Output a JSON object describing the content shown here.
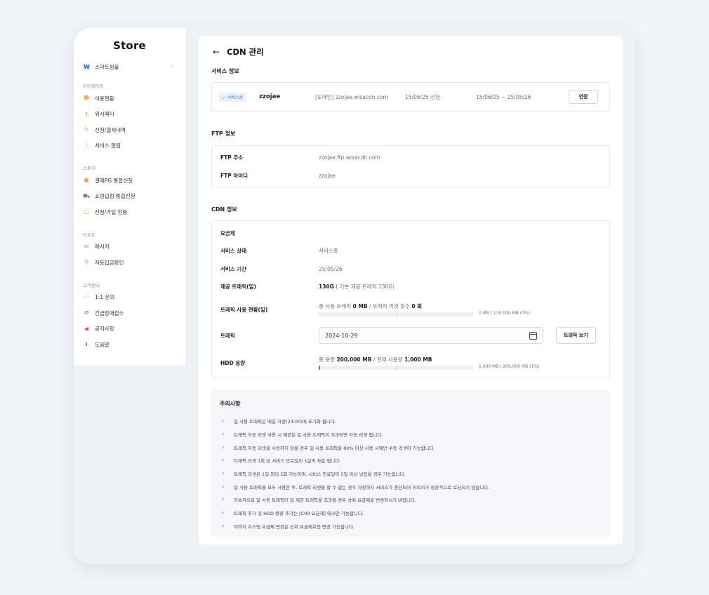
{
  "sidebar": {
    "brand": "Store",
    "smart": {
      "logo": "W",
      "label": "스마트윙올"
    },
    "sections": [
      {
        "title": "마이페이지",
        "items": [
          {
            "label": "이용현황",
            "icon": "smile-icon",
            "glyph": "☻",
            "color": "#f5a524"
          },
          {
            "label": "위시페이",
            "icon": "key-icon",
            "glyph": "⚷",
            "color": "#f2a516"
          },
          {
            "label": "신청/결제내역",
            "icon": "memo-icon",
            "glyph": "✎",
            "color": "#e8a23b"
          },
          {
            "label": "서비스 알림",
            "icon": "bell-icon",
            "glyph": "♪",
            "color": "#f0b429"
          }
        ]
      },
      {
        "title": "스토어",
        "items": [
          {
            "label": "결제PG 통합신청",
            "icon": "moneybag-icon",
            "glyph": "●",
            "color": "#e9a83a"
          },
          {
            "label": "쇼핑입점 통합신청",
            "icon": "cart-icon",
            "glyph": "⛟",
            "color": "#6b7280"
          },
          {
            "label": "신청/가입 현황",
            "icon": "clipboard-icon",
            "glyph": "▢",
            "color": "#e0a93e"
          }
        ]
      },
      {
        "title": "리포트",
        "items": [
          {
            "label": "메시지",
            "icon": "mail-icon",
            "glyph": "✉",
            "color": "#9aa3ae"
          },
          {
            "label": "자동입금확인",
            "icon": "magnifier-icon",
            "glyph": "⚲",
            "color": "#9aa3ae"
          }
        ]
      },
      {
        "title": "고객센터",
        "items": [
          {
            "label": "1:1 문의",
            "icon": "chat-icon",
            "glyph": "⋯",
            "color": "#6b7280"
          },
          {
            "label": "긴급장애접수",
            "icon": "prohibited-icon",
            "glyph": "⊘",
            "color": "#e5484d"
          },
          {
            "label": "공지사항",
            "icon": "megaphone-icon",
            "glyph": "◀",
            "color": "#e5484d"
          },
          {
            "label": "도움말",
            "icon": "info-icon",
            "glyph": "ℹ",
            "color": "#6b7280"
          }
        ]
      }
    ]
  },
  "main": {
    "title": "CDN 관리",
    "service": {
      "section_title": "서비스 정보",
      "badge": "✓ 서비스중",
      "id": "zzojae",
      "domain": "[도메인] zzojae.wisacdn.com",
      "applied": "15/06/25 신청",
      "period": "15/06/25 ~ 25/05/26",
      "extend_label": "연장"
    },
    "ftp": {
      "section_title": "FTP 정보",
      "address_label": "FTP 주소",
      "address_value": "zzojae.ftp.wisacdn.com",
      "id_label": "FTP 아이디",
      "id_value": "zzojae"
    },
    "cdn": {
      "section_title": "CDN 정보",
      "plan_label": "요금제",
      "status_label": "서비스 상태",
      "status_value": "서비스중",
      "period_label": "서비스 기간",
      "period_value": "25/05/26",
      "daily_traffic_label": "제공 트래픽(일)",
      "daily_traffic_value": "130G",
      "daily_traffic_note": "( 기본 제공 트래픽 130G)",
      "usage_label": "트래픽 사용 현황(일)",
      "usage_prefix": "총 사용 트래픽 ",
      "usage_used": "0 MB",
      "usage_mid": " / 트래픽 리셋 횟수 ",
      "usage_resets": "0 회",
      "usage_meter_text": "0 MB / 130,000 MB (0%)",
      "usage_fraction": 0.0,
      "traffic_label": "트래픽",
      "traffic_date": "2024-10-29",
      "traffic_button": "트래픽 보기",
      "hdd_label": "HDD 용량",
      "hdd_prefix": "총 용량 ",
      "hdd_total": "200,000 MB",
      "hdd_mid": " / 현재 사용량 ",
      "hdd_used": "1,000 MB",
      "hdd_meter_text": "1,000 MB / 200,000 MB (1%)",
      "hdd_fraction": 0.01
    },
    "notice": {
      "title": "주의사항",
      "items": [
        "일 사용 트래픽은 매일 자정(24:00)에 초기화 됩니다.",
        "트래픽 자동 리셋 사용 시 제공된 일 사용 트래픽이 초과되면 자동 리셋 됩니다.",
        "트래픽 자동 리셋을 사용하지 않을 경우 일 사용 트래픽을 80% 이상 사용 시에만 수동 리셋이 가능합니다.",
        "트래픽 리셋 1회 당 서비스 만료일이 1일씩 차감 됩니다.",
        "트래픽 리셋은 1일 최대 5회 가능하며, 서비스 만료일이 5일 이상 남았을 경우 가능합니다.",
        "일 사용 트래픽을 모두 사용한 후, 트래픽 리셋을 할 수 없는 경우 자정까지 서비스가 중단되어 이미지가 정상적으로 로딩되지 않습니다.",
        "지속적으로 일 사용 트래픽이 일 제공 트래픽을 초과할 경우 상위 요금제로 변경하시기 바랍니다.",
        "트래픽 추가 및 HDD 용량 추가는 [C99 요금제] 에서만 가능합니다.",
        "이미지 호스팅 요금제 변경은 상위 요금제로만 변경 가능합니다."
      ]
    }
  }
}
